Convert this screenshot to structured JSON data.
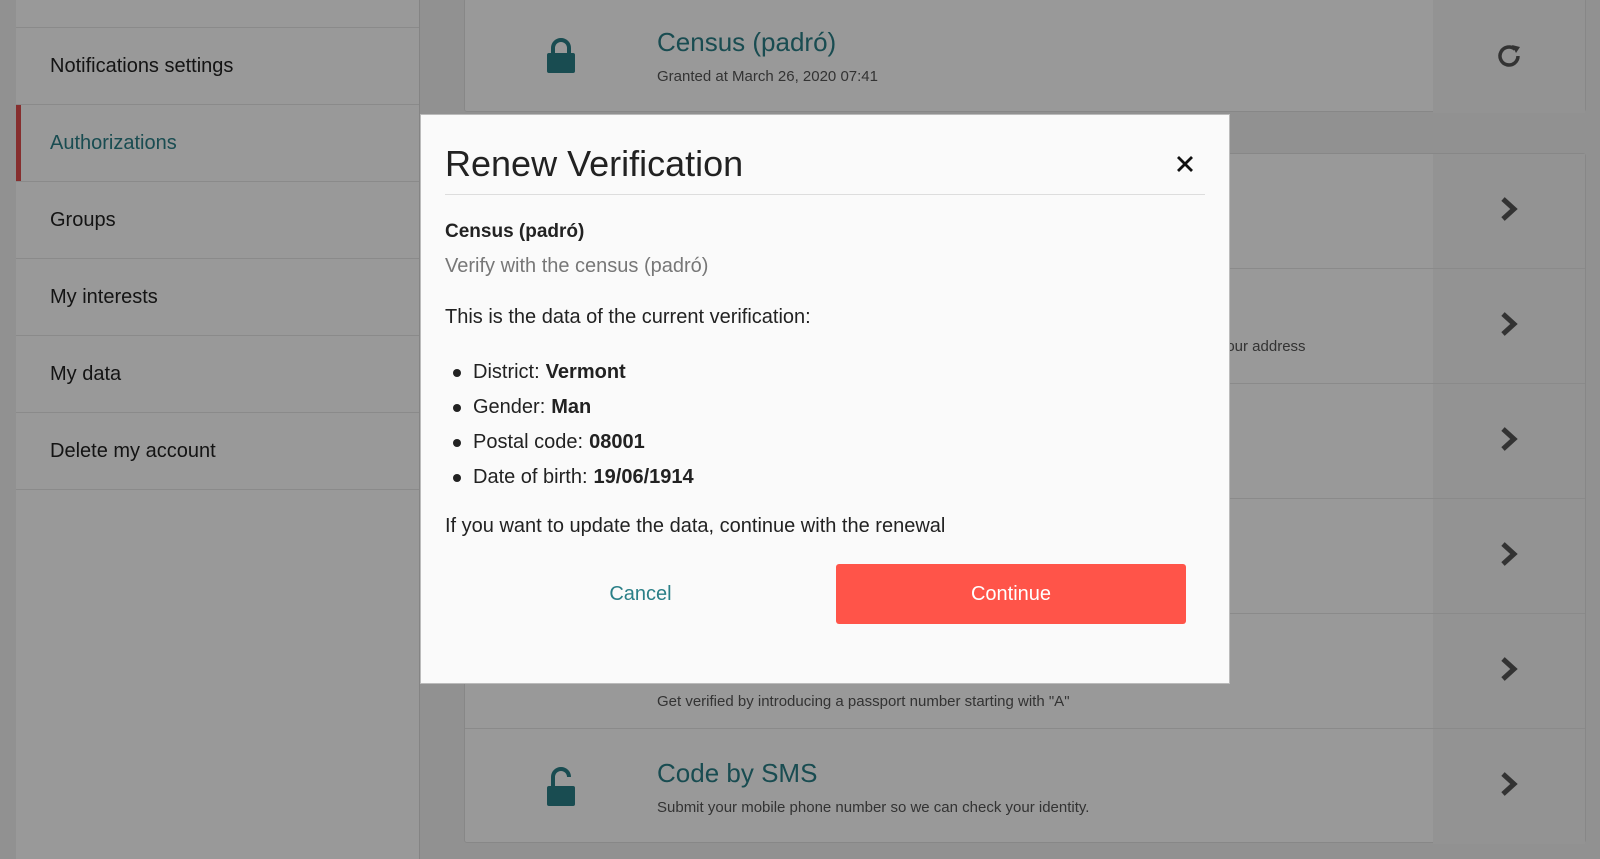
{
  "sidebar": {
    "items": [
      {
        "label": "Notifications settings"
      },
      {
        "label": "Authorizations"
      },
      {
        "label": "Groups"
      },
      {
        "label": "My interests"
      },
      {
        "label": "My data"
      },
      {
        "label": "Delete my account"
      }
    ]
  },
  "granted": {
    "title": "Census (padró)",
    "desc": "Granted at March 26, 2020 07:41"
  },
  "pending": {
    "row2_desc": "fy your address",
    "row5_desc": "Get verified by introducing a passport number starting with \"A\"",
    "row6_title": "Code by SMS",
    "row6_desc": "Submit your mobile phone number so we can check your identity."
  },
  "modal": {
    "title": "Renew Verification",
    "auth_name": "Census (padró)",
    "auth_desc": "Verify with the census (padró)",
    "intro": "This is the data of the current verification:",
    "data": [
      {
        "label": "District:",
        "value": "Vermont"
      },
      {
        "label": "Gender:",
        "value": "Man"
      },
      {
        "label": "Postal code:",
        "value": "08001"
      },
      {
        "label": "Date of birth:",
        "value": "19/06/1914"
      }
    ],
    "outro": "If you want to update the data, continue with the renewal",
    "cancel_label": "Cancel",
    "continue_label": "Continue"
  },
  "colors": {
    "accent": "#2a7f87",
    "primary_button": "#ff5449",
    "active_marker": "#e04e4e"
  }
}
